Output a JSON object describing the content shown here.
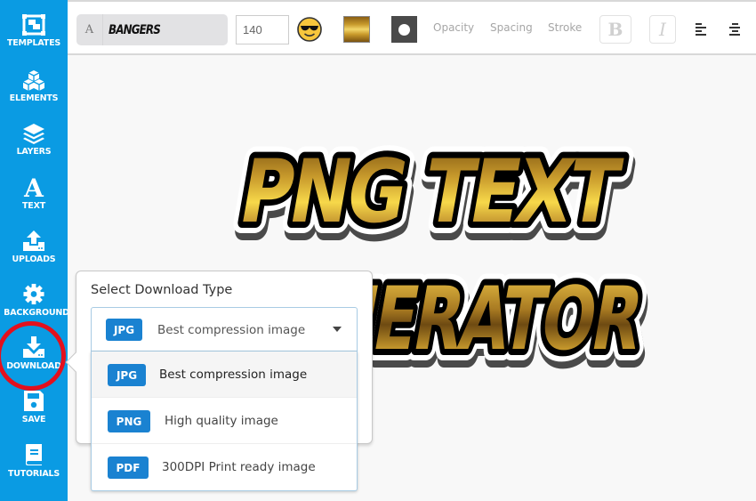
{
  "sidebar": {
    "items": [
      {
        "label": "TEMPLATES",
        "icon": "templates-icon"
      },
      {
        "label": "ELEMENTS",
        "icon": "cubes-icon"
      },
      {
        "label": "LAYERS",
        "icon": "layers-icon"
      },
      {
        "label": "TEXT",
        "icon": "text-a-icon"
      },
      {
        "label": "UPLOADS",
        "icon": "upload-icon"
      },
      {
        "label": "BACKGROUND",
        "icon": "gear-icon"
      },
      {
        "label": "DOWNLOAD",
        "icon": "download-icon"
      },
      {
        "label": "SAVE",
        "icon": "floppy-disk-icon"
      },
      {
        "label": "TUTORIALS",
        "icon": "book-icon"
      }
    ],
    "highlighted": "DOWNLOAD",
    "color": "#0a9be3",
    "highlight_ring_color": "#e3101d"
  },
  "toolbar": {
    "font_prefix": "A",
    "font_name": "BANGERS",
    "font_size": "140",
    "emoji": "sunglasses-emoji",
    "fill": "gold-gradient",
    "shape": "circle",
    "opacity_label": "Opacity",
    "spacing_label": "Spacing",
    "stroke_label": "Stroke",
    "bold_label": "B",
    "italic_label": "I",
    "align_left": "align-left-icon",
    "align_center": "align-center-icon"
  },
  "canvas": {
    "text_line1": "PNG TEXT",
    "text_line2": "GENERATOR",
    "gold_colors": [
      "#7a5210",
      "#c89a2c",
      "#f7d84a",
      "#b8862a",
      "#6e4a12"
    ]
  },
  "popover": {
    "title": "Select Download Type",
    "selected": {
      "badge": "JPG",
      "label": "Best compression image"
    },
    "options": [
      {
        "badge": "JPG",
        "label": "Best compression image",
        "active": true
      },
      {
        "badge": "PNG",
        "label": "High quality image",
        "active": false
      },
      {
        "badge": "PDF",
        "label": "300DPI Print ready image",
        "active": false
      }
    ],
    "badge_color": "#1a82d1"
  }
}
